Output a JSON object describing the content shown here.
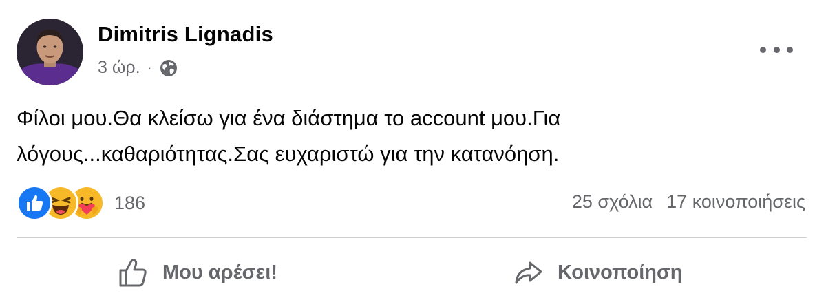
{
  "post": {
    "author": "Dimitris Lignadis",
    "time": "3 ώρ.",
    "separator": "·",
    "privacy_icon": "globe-icon",
    "more_icon": "more-options-icon",
    "text": "Φίλοι μου.Θα κλείσω για ένα διάστημα το account μου.Για λόγους...καθαριότητας.Σας ευχαριστώ για την κατανόηση."
  },
  "reactions": {
    "icons": [
      "like-reaction-icon",
      "haha-reaction-icon",
      "care-reaction-icon"
    ],
    "count": "186"
  },
  "stats": {
    "comments": "25 σχόλια",
    "shares": "17 κοινοποιήσεις"
  },
  "actions": {
    "like_label": "Μου αρέσει!",
    "share_label": "Κοινοποίηση"
  },
  "colors": {
    "text": "#050505",
    "secondary": "#65676b",
    "like_blue": "#1877f2",
    "divider": "#ced0d4"
  }
}
